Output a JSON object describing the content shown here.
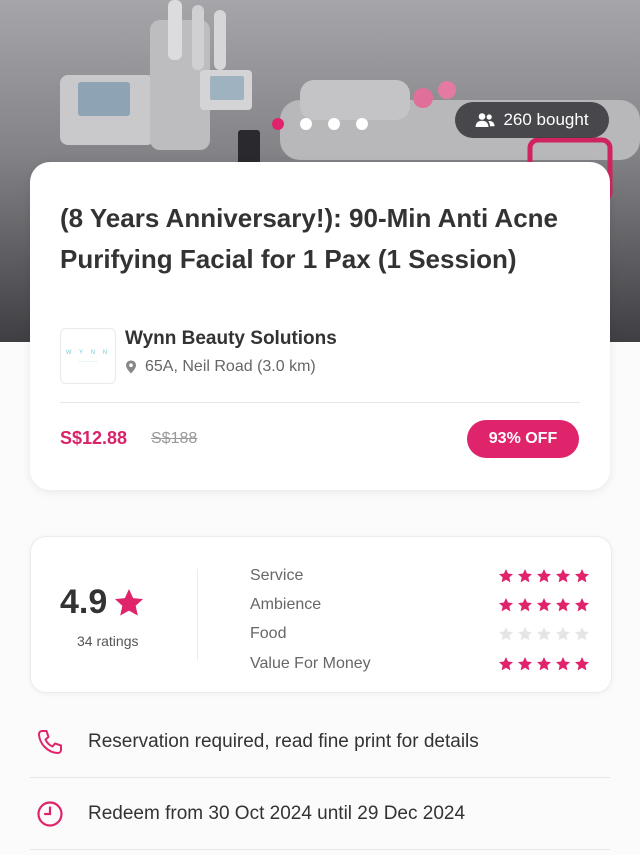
{
  "gallery": {
    "dot_count": 4,
    "active_index": 0,
    "bought_label": "260 bought"
  },
  "deal": {
    "title": "(8 Years Anniversary!): 90-Min Anti Acne Purifying Facial for 1 Pax (1 Session)",
    "merchant_name": "Wynn Beauty Solutions",
    "address": "65A, Neil Road (3.0 km)",
    "price": "S$12.88",
    "original_price": "S$188",
    "discount": "93% OFF",
    "logo_icon": "merchant-logo"
  },
  "ratings": {
    "score": "4.9",
    "count_label": "34 ratings",
    "categories": [
      {
        "label": "Service",
        "stars": 5
      },
      {
        "label": "Ambience",
        "stars": 5
      },
      {
        "label": "Food",
        "stars": 0
      },
      {
        "label": "Value For Money",
        "stars": 5
      }
    ]
  },
  "info": [
    {
      "icon": "phone-icon",
      "text": "Reservation required, read fine print for details"
    },
    {
      "icon": "clock-icon",
      "text": "Redeem from 30 Oct 2024 until 29 Dec 2024"
    }
  ],
  "colors": {
    "accent": "#e0246b",
    "price": "#d8236a",
    "star_empty": "#e5e5e5"
  }
}
